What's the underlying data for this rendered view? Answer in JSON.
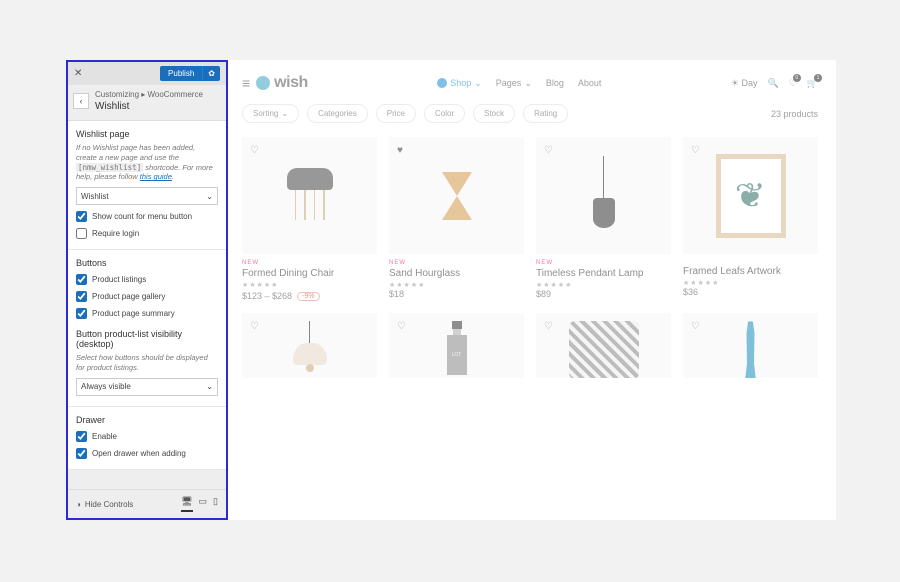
{
  "panel": {
    "publish": "Publish",
    "breadcrumb": "Customizing  ▸  WooCommerce",
    "title": "Wishlist",
    "wishlist_page": {
      "heading": "Wishlist page",
      "desc_prefix": "If no Wishlist page has been added, create a new page and use the ",
      "desc_code": "[nmw_wishlist]",
      "desc_suffix": " shortcode. For more help, please follow ",
      "guide_link": "this guide",
      "select_value": "Wishlist",
      "show_count": "Show count for menu button",
      "require_login": "Require login"
    },
    "buttons": {
      "heading": "Buttons",
      "listings": "Product listings",
      "gallery": "Product page gallery",
      "summary": "Product page summary",
      "visibility_heading": "Button product-list visibility (desktop)",
      "visibility_desc": "Select how buttons should be displayed for product listings.",
      "visibility_value": "Always visible"
    },
    "drawer": {
      "heading": "Drawer",
      "enable": "Enable",
      "open_when_adding": "Open drawer when adding"
    },
    "footer": {
      "hide_controls": "Hide Controls"
    }
  },
  "preview": {
    "logo": "wish",
    "nav": {
      "shop": "Shop",
      "pages": "Pages",
      "blog": "Blog",
      "about": "About"
    },
    "day": "Day",
    "filters": {
      "sorting": "Sorting",
      "categories": "Categories",
      "price": "Price",
      "color": "Color",
      "stock": "Stock",
      "rating": "Rating"
    },
    "count": "23 products",
    "products": [
      {
        "new": "NEW",
        "title": "Formed Dining Chair",
        "price": "$123 – $268",
        "discount": "-9%"
      },
      {
        "new": "NEW",
        "title": "Sand Hourglass",
        "price": "$18"
      },
      {
        "new": "NEW",
        "title": "Timeless Pendant Lamp",
        "price": "$89"
      },
      {
        "title": "Framed Leafs Artwork",
        "price": "$36"
      }
    ]
  }
}
